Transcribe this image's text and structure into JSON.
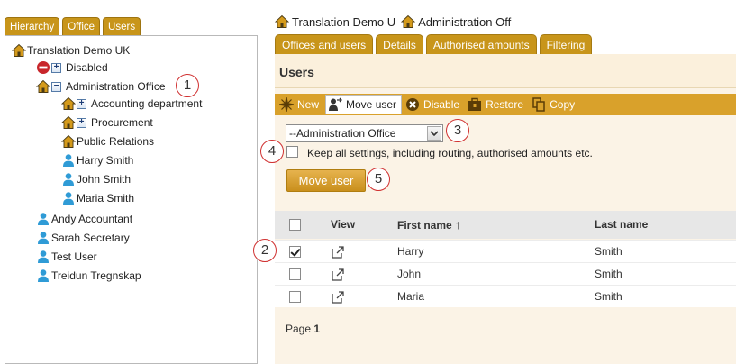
{
  "left_tabs": [
    "Hierarchy",
    "Office",
    "Users"
  ],
  "tree": [
    {
      "label": "Translation Demo UK",
      "icon": "house-icon"
    },
    {
      "label": "Disabled",
      "icon": "no-entry-icon",
      "expander": "+"
    },
    {
      "label": "Administration Office",
      "icon": "house-icon",
      "expander": "−"
    },
    {
      "label": "Accounting department",
      "icon": "house-icon",
      "expander": "+"
    },
    {
      "label": "Procurement",
      "icon": "house-icon",
      "expander": "+"
    },
    {
      "label": "Public Relations",
      "icon": "house-icon"
    },
    {
      "label": "Harry Smith",
      "icon": "user-icon"
    },
    {
      "label": "John Smith",
      "icon": "user-icon"
    },
    {
      "label": "Maria Smith",
      "icon": "user-icon"
    },
    {
      "label": "Andy Accountant",
      "icon": "user-icon"
    },
    {
      "label": "Sarah Secretary",
      "icon": "user-icon"
    },
    {
      "label": "Test User",
      "icon": "user-icon"
    },
    {
      "label": "Treidun Tregnskap",
      "icon": "user-icon"
    }
  ],
  "breadcrumb": [
    "Translation Demo U",
    "Administration Off"
  ],
  "right_tabs": [
    "Offices and users",
    "Details",
    "Authorised amounts",
    "Filtering"
  ],
  "section_title": "Users",
  "toolbar": {
    "new": "New",
    "move_user": "Move user",
    "disable": "Disable",
    "restore": "Restore",
    "copy": "Copy"
  },
  "target_office": {
    "selected": "--Administration Office"
  },
  "keep_settings_label": "Keep all settings, including routing, authorised amounts etc.",
  "keep_settings_checked": false,
  "move_button_label": "Move user",
  "grid": {
    "columns": {
      "view": "View",
      "first_name": "First name",
      "sort_arrow": "↑",
      "last_name": "Last name"
    },
    "rows": [
      {
        "first_name": "Harry",
        "last_name": "Smith",
        "checked": true
      },
      {
        "first_name": "John",
        "last_name": "Smith",
        "checked": false
      },
      {
        "first_name": "Maria",
        "last_name": "Smith",
        "checked": false
      }
    ]
  },
  "pager": {
    "label": "Page",
    "page": "1"
  },
  "callouts": [
    "1",
    "2",
    "3",
    "4",
    "5"
  ],
  "colors": {
    "tab_gold": "#c8951a",
    "toolbar_gold": "#d9a12b",
    "panel_cream": "#fbf3e6",
    "callout_red": "#d03030"
  }
}
